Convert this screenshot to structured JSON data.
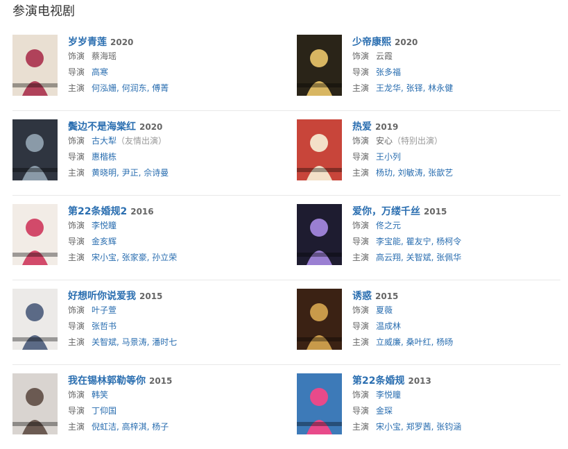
{
  "page": {
    "title": "参演电视剧"
  },
  "labels": {
    "role": "饰演",
    "director": "导演",
    "starring": "主演"
  },
  "shows": [
    {
      "title": "岁岁青莲",
      "year": "2020",
      "role": "蔡海瑶",
      "role_note": "",
      "director": "高寒",
      "starring": "何泓姗, 何润东, 傅菁",
      "poster_color": "#e9dfd2",
      "poster_accent": "#b0425a"
    },
    {
      "title": "少帝康熙",
      "year": "2020",
      "role": "云霞",
      "role_note": "",
      "director": "张多福",
      "starring": "王龙华, 张铎, 林永健",
      "poster_color": "#2a2418",
      "poster_accent": "#d8b662"
    },
    {
      "title": "鬓边不是海棠红",
      "year": "2020",
      "role": "古大犁",
      "role_note": "（友情出演）",
      "director": "惠楷栋",
      "starring": "黄晓明, 尹正, 佘诗曼",
      "poster_color": "#2f3540",
      "poster_accent": "#8a9aa8"
    },
    {
      "title": "热爱",
      "year": "2019",
      "role": "安心",
      "role_note": "（特别出演）",
      "director": "王小列",
      "starring": "杨玏, 刘敏涛, 张歆艺",
      "poster_color": "#c8453a",
      "poster_accent": "#f3e0c8"
    },
    {
      "title": "第22条婚规2",
      "year": "2016",
      "role": "李悦瞳",
      "role_note": "",
      "director": "金亥辉",
      "starring": "宋小宝, 张家豪, 孙立荣",
      "poster_color": "#f2ece6",
      "poster_accent": "#d24a6a"
    },
    {
      "title": "爱你，万缕千丝",
      "year": "2015",
      "role": "佟之元",
      "role_note": "",
      "director": "李宝能, 瞿友宁, 杨柯令",
      "starring": "高云翔, 关智斌, 张佩华",
      "poster_color": "#1e1c30",
      "poster_accent": "#9a7fd2"
    },
    {
      "title": "好想听你说爱我",
      "year": "2015",
      "role": "叶子萱",
      "role_note": "",
      "director": "张哲书",
      "starring": "关智斌, 马景涛, 潘时七",
      "poster_color": "#eceae8",
      "poster_accent": "#5b6a86"
    },
    {
      "title": "诱惑",
      "year": "2015",
      "role": "夏薇",
      "role_note": "",
      "director": "温成林",
      "starring": "立威廉, 桑叶红, 杨旸",
      "poster_color": "#3b2214",
      "poster_accent": "#c89a4a"
    },
    {
      "title": "我在锡林郭勒等你",
      "year": "2015",
      "role": "韩笑",
      "role_note": "",
      "director": "丁仰国",
      "starring": "倪虹洁, 高梓淇, 杨子",
      "poster_color": "#d9d4d0",
      "poster_accent": "#6b5a52"
    },
    {
      "title": "第22条婚规",
      "year": "2013",
      "role": "李悦瞳",
      "role_note": "",
      "director": "金琛",
      "starring": "宋小宝, 郑罗茜, 张钧涵",
      "poster_color": "#3d7ab8",
      "poster_accent": "#e84a8a"
    }
  ]
}
